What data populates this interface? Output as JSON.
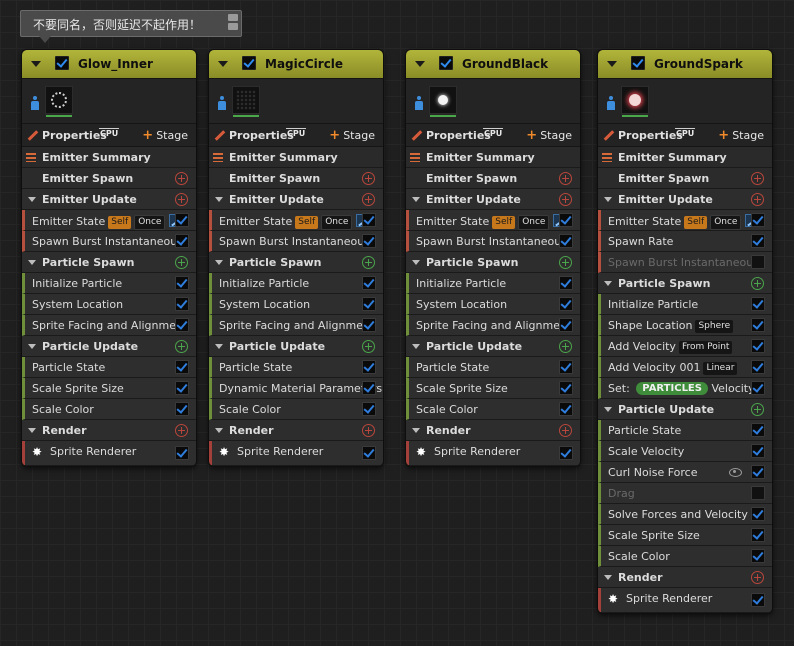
{
  "tooltip": {
    "text": "不要同名，否则延迟不起作用！"
  },
  "common": {
    "properties": "Properties",
    "cpu": "CPU",
    "stage": "Stage",
    "emitter_summary": "Emitter Summary",
    "emitter_spawn": "Emitter Spawn",
    "emitter_update": "Emitter Update",
    "particle_spawn": "Particle Spawn",
    "particle_update": "Particle Update",
    "render": "Render",
    "sprite_renderer": "Sprite Renderer",
    "emitter_state": "Emitter State",
    "self": "Self",
    "once": "Once"
  },
  "emitters": [
    {
      "name": "Glow_Inner",
      "enabled": true,
      "thumbnail": "ring-texture",
      "emitter_update": [
        {
          "label": "Spawn Burst Instantaneous",
          "enabled": true
        }
      ],
      "particle_spawn": [
        {
          "label": "Initialize Particle"
        },
        {
          "label": "System Location"
        },
        {
          "label": "Sprite Facing and Alignment"
        }
      ],
      "particle_update": [
        {
          "label": "Particle State"
        },
        {
          "label": "Scale Sprite Size"
        },
        {
          "label": "Scale Color"
        }
      ]
    },
    {
      "name": "MagicCircle",
      "enabled": true,
      "thumbnail": "dotted-texture",
      "emitter_update": [
        {
          "label": "Spawn Burst Instantaneous",
          "enabled": true
        }
      ],
      "particle_spawn": [
        {
          "label": "Initialize Particle"
        },
        {
          "label": "System Location"
        },
        {
          "label": "Sprite Facing and Alignment"
        }
      ],
      "particle_update": [
        {
          "label": "Particle State"
        },
        {
          "label": "Dynamic Material Parameters"
        },
        {
          "label": "Scale Color"
        }
      ]
    },
    {
      "name": "GroundBlack",
      "enabled": true,
      "thumbnail": "white-ball-texture",
      "emitter_update": [
        {
          "label": "Spawn Burst Instantaneous",
          "enabled": true
        }
      ],
      "particle_spawn": [
        {
          "label": "Initialize Particle"
        },
        {
          "label": "System Location"
        },
        {
          "label": "Sprite Facing and Alignment"
        }
      ],
      "particle_update": [
        {
          "label": "Particle State"
        },
        {
          "label": "Scale Sprite Size"
        },
        {
          "label": "Scale Color"
        }
      ]
    },
    {
      "name": "GroundSpark",
      "enabled": true,
      "thumbnail": "red-spark-texture",
      "emitter_update": [
        {
          "label": "Spawn Rate",
          "enabled": true
        },
        {
          "label": "Spawn Burst Instantaneous",
          "enabled": false
        }
      ],
      "particle_spawn": [
        {
          "label": "Initialize Particle"
        },
        {
          "label": "Shape Location",
          "tag": "Sphere"
        },
        {
          "label": "Add Velocity",
          "tag": "From Point"
        },
        {
          "label": "Add Velocity 001",
          "tag": "Linear"
        },
        {
          "label": "Set:",
          "pill": "PARTICLES",
          "suffix": "Velocity"
        }
      ],
      "particle_update": [
        {
          "label": "Particle State",
          "enabled": true
        },
        {
          "label": "Scale Velocity",
          "enabled": true
        },
        {
          "label": "Curl Noise Force",
          "enabled": true,
          "eye": true
        },
        {
          "label": "Drag",
          "enabled": false
        },
        {
          "label": "Solve Forces and Velocity",
          "enabled": true
        },
        {
          "label": "Scale Sprite Size",
          "enabled": true
        },
        {
          "label": "Scale Color",
          "enabled": true
        }
      ]
    }
  ],
  "colors": {
    "header": "#b2b53a",
    "emitter_stripe": "#b5503f",
    "particle_stripe": "#6f8f3a",
    "check": "#2f7ddc",
    "add_red": "#b8463c",
    "add_green": "#4aa44a"
  }
}
